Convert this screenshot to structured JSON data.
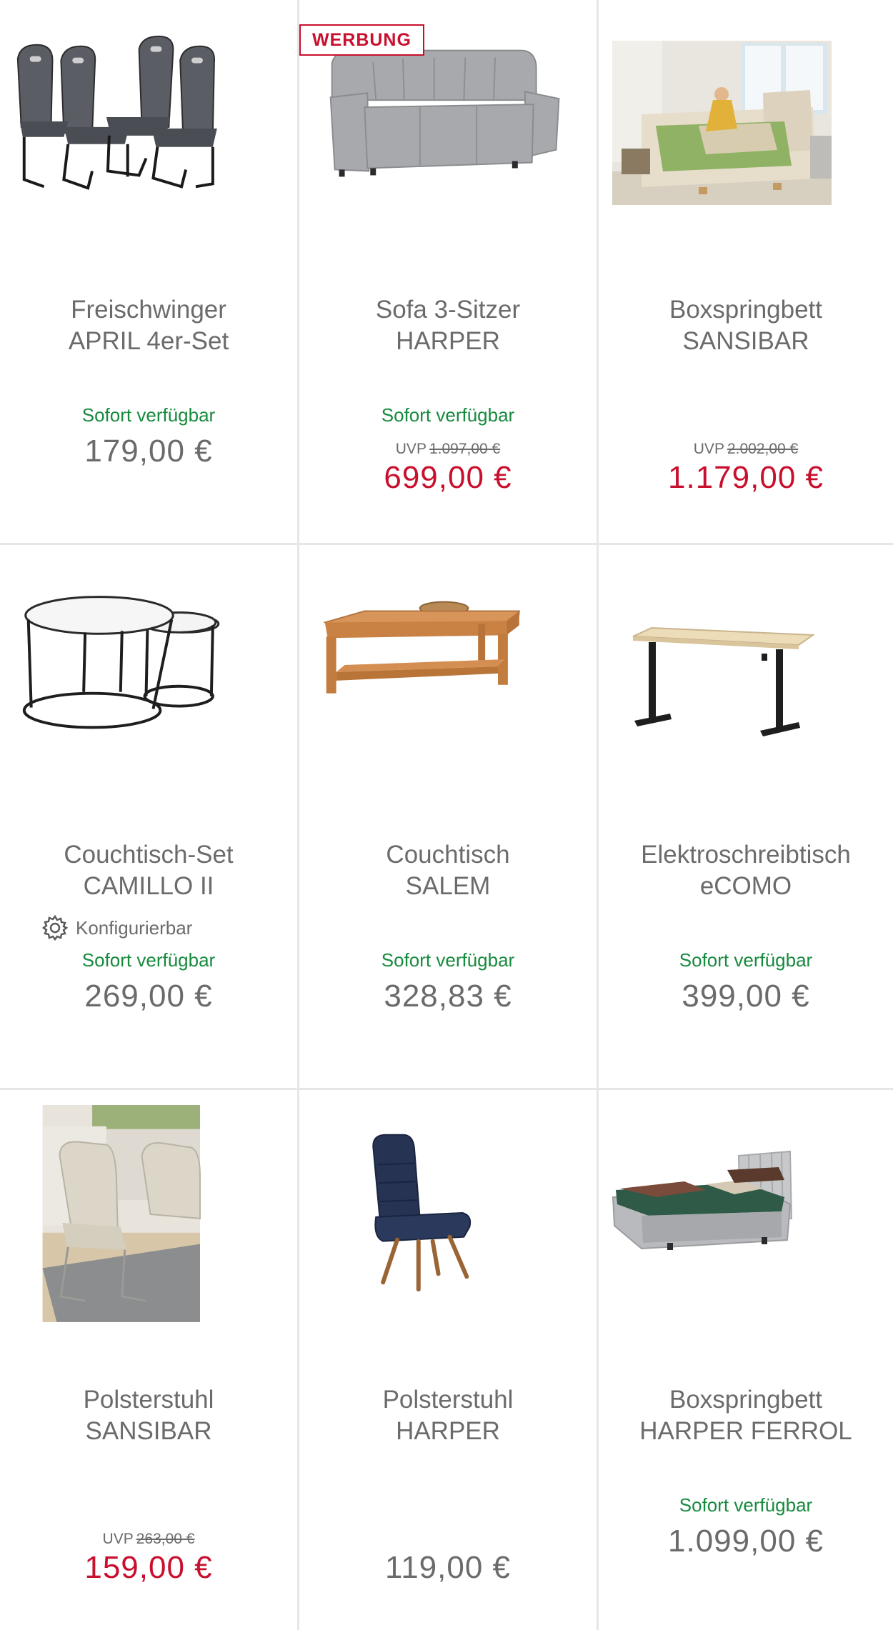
{
  "colors": {
    "available": "#178a3e",
    "sale": "#c8102e",
    "text": "#6b6b6b",
    "divider": "#e6e6e6"
  },
  "products": [
    {
      "image_icon": "cantilever-chairs-icon",
      "ad_badge": "",
      "name_line1": "Freischwinger",
      "name_line2": "APRIL 4er-Set",
      "configurable": "",
      "availability": "Sofort verfügbar",
      "uvp_label": "",
      "uvp_old": "",
      "price": "179,00 €",
      "price_sale": ""
    },
    {
      "image_icon": "sofa-icon",
      "ad_badge": "WERBUNG",
      "name_line1": "Sofa 3-Sitzer",
      "name_line2": "HARPER",
      "configurable": "",
      "availability": "Sofort verfügbar",
      "uvp_label": "UVP",
      "uvp_old": "1.097,00 €",
      "price": "",
      "price_sale": "699,00 €"
    },
    {
      "image_icon": "boxspring-bed-photo",
      "ad_badge": "",
      "name_line1": "Boxspringbett",
      "name_line2": "SANSIBAR",
      "configurable": "",
      "availability": "",
      "uvp_label": "UVP",
      "uvp_old": "2.002,00 €",
      "price": "",
      "price_sale": "1.179,00 €"
    },
    {
      "image_icon": "nesting-tables-icon",
      "ad_badge": "",
      "name_line1": "Couchtisch-Set",
      "name_line2": "CAMILLO II",
      "configurable": "Konfigurierbar",
      "availability": "Sofort verfügbar",
      "uvp_label": "",
      "uvp_old": "",
      "price": "269,00 €",
      "price_sale": ""
    },
    {
      "image_icon": "coffee-table-icon",
      "ad_badge": "",
      "name_line1": "Couchtisch",
      "name_line2": "SALEM",
      "configurable": "",
      "availability": "Sofort verfügbar",
      "uvp_label": "",
      "uvp_old": "",
      "price": "328,83 €",
      "price_sale": ""
    },
    {
      "image_icon": "standing-desk-icon",
      "ad_badge": "",
      "name_line1": "Elektroschreibtisch",
      "name_line2": "eCOMO",
      "configurable": "",
      "availability": "Sofort verfügbar",
      "uvp_label": "",
      "uvp_old": "",
      "price": "399,00 €",
      "price_sale": ""
    },
    {
      "image_icon": "upholstered-chair-photo",
      "ad_badge": "",
      "name_line1": "Polsterstuhl",
      "name_line2": "SANSIBAR",
      "configurable": "",
      "availability": "",
      "uvp_label": "UVP",
      "uvp_old": "263,00 €",
      "price": "",
      "price_sale": "159,00 €"
    },
    {
      "image_icon": "dining-chair-icon",
      "ad_badge": "",
      "name_line1": "Polsterstuhl",
      "name_line2": "HARPER",
      "configurable": "",
      "availability": "",
      "uvp_label": "",
      "uvp_old": "",
      "price": "119,00 €",
      "price_sale": ""
    },
    {
      "image_icon": "boxspring-bed-icon",
      "ad_badge": "",
      "name_line1": "Boxspringbett",
      "name_line2": "HARPER FERROL",
      "configurable": "",
      "availability": "Sofort verfügbar",
      "uvp_label": "",
      "uvp_old": "",
      "price": "1.099,00 €",
      "price_sale": ""
    }
  ]
}
